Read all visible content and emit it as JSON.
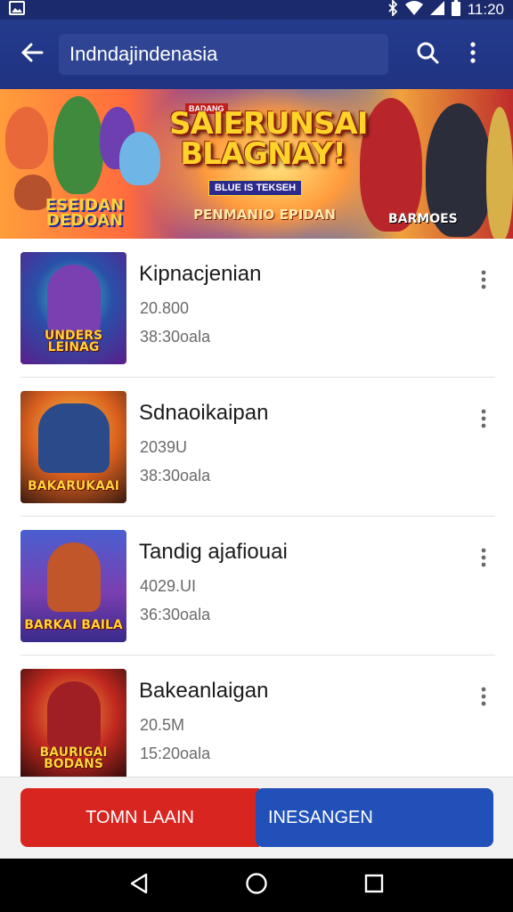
{
  "status_bar": {
    "time": "11:20",
    "icons": [
      "image-icon",
      "bluetooth-icon",
      "wifi-icon",
      "signal-icon",
      "battery-icon"
    ]
  },
  "app_bar": {
    "search_value": "Indndajindenasia",
    "icons": {
      "back": "back-arrow-icon",
      "search": "search-icon",
      "more": "more-vert-icon"
    }
  },
  "banner": {
    "headline": "SAIERUNSAI BLAGNAY!",
    "tag_left": "BADANG",
    "tag_small": "BLUE IS TEKSEH",
    "subline": "PENMANIO EPIDAN",
    "logo_left": "ESEIDAN DEDOAN",
    "right_label": "BARMOES"
  },
  "items": [
    {
      "title": "Kipnacjenian",
      "meta1": "20.800",
      "meta2": "38:30oala",
      "thumb_caption": "UNDERS LEINAG"
    },
    {
      "title": "Sdnaoikaipan",
      "meta1": "2039U",
      "meta2": "38:30oala",
      "thumb_caption": "BAKARUKAAI"
    },
    {
      "title": "Tandig ajafiouai",
      "meta1": "4029.UI",
      "meta2": "36:30oala",
      "thumb_caption": "BARKAI BAILA"
    },
    {
      "title": "Bakeanlaigan",
      "meta1": "20.5M",
      "meta2": "15:20oala",
      "thumb_caption": "BAURIGAI BODANS"
    }
  ],
  "actions": {
    "primary_label": "TOMN LAAIN",
    "secondary_label": "INESANGEN"
  },
  "colors": {
    "app_bar": "#1f3381",
    "primary_button": "#d9251f",
    "secondary_button": "#2150b8"
  }
}
